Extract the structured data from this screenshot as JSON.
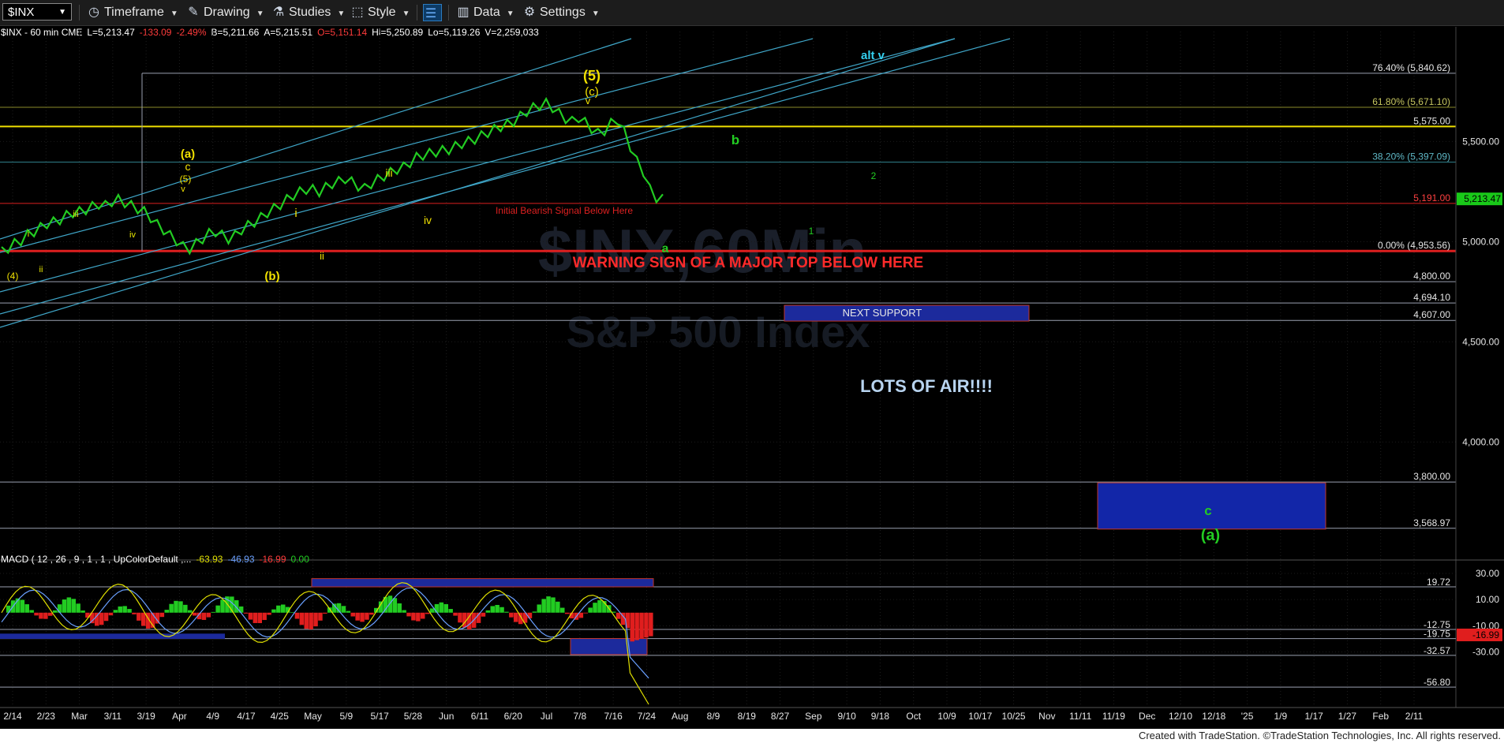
{
  "toolbar": {
    "symbol": "$INX",
    "timeframe": "Timeframe",
    "drawing": "Drawing",
    "studies": "Studies",
    "style": "Style",
    "data": "Data",
    "settings": "Settings"
  },
  "header": {
    "title": "$INX - 60 min  CME",
    "last": "L=5,213.47",
    "chg": "-133.09",
    "pct": "-2.49%",
    "bid": "B=5,211.66",
    "ask": "A=5,215.51",
    "open": "O=5,151.14",
    "high": "Hi=5,250.89",
    "low": "Lo=5,119.26",
    "vol": "V=2,259,033"
  },
  "watermark": {
    "line1": "$INX,60Min",
    "line2": "S&P 500 Index"
  },
  "colors": {
    "price": "#22cc22",
    "fib": "#9aa0b0",
    "channel": "#3fa6c8",
    "resistance": "#f0e000",
    "signal": "#dd1f1f",
    "support_box": "#1c2a9c"
  },
  "chart_data": {
    "type": "line",
    "title": "$INX - 60 min",
    "price_axis": {
      "ticks": [
        5500,
        5000,
        4500,
        4000
      ],
      "labels": [
        "5,500.00",
        "5,000.00",
        "4,500.00",
        "4,000.00"
      ],
      "ylim": [
        3450,
        5990
      ],
      "scale": "linear"
    },
    "time_axis": {
      "labels": [
        "2/14",
        "2/23",
        "Mar",
        "3/11",
        "3/19",
        "Apr",
        "4/9",
        "4/17",
        "4/25",
        "May",
        "5/9",
        "5/17",
        "5/28",
        "Jun",
        "6/11",
        "6/20",
        "Jul",
        "7/8",
        "7/16",
        "7/24",
        "Aug",
        "8/9",
        "8/19",
        "8/27",
        "Sep",
        "9/10",
        "9/18",
        "Oct",
        "10/9",
        "10/17",
        "10/25",
        "Nov",
        "11/11",
        "11/19",
        "Dec",
        "12/10",
        "12/18",
        "'25",
        "1/9",
        "1/17",
        "1/27",
        "Feb",
        "2/11"
      ]
    },
    "last_price": {
      "value": 5213.47,
      "label": "5,213.47"
    },
    "series": [
      {
        "values": [
          4950,
          4968,
          4990,
          5005,
          5035,
          5050,
          5070,
          5090,
          5098,
          5110,
          5130,
          5145,
          5150,
          5160,
          5175,
          5188,
          5180,
          5200,
          5210,
          5195,
          5180,
          5165,
          5150,
          5120,
          5085,
          5060,
          5030,
          5005,
          4975,
          4965,
          4990,
          5015,
          5040,
          5050,
          5032,
          5015,
          5030,
          5060,
          5080,
          5098,
          5120,
          5145,
          5165,
          5185,
          5210,
          5232,
          5248,
          5262,
          5260,
          5250,
          5270,
          5290,
          5300,
          5315,
          5298,
          5278,
          5265,
          5290,
          5310,
          5328,
          5345,
          5362,
          5372,
          5395,
          5420,
          5432,
          5440,
          5448,
          5455,
          5460,
          5475,
          5490,
          5500,
          5512,
          5528,
          5545,
          5560,
          5575,
          5585,
          5600,
          5625,
          5650,
          5668,
          5680,
          5690,
          5670,
          5640,
          5615,
          5600,
          5620,
          5595,
          5565,
          5540,
          5555,
          5590,
          5610,
          5550,
          5475,
          5400,
          5350,
          5260,
          5220,
          5213
        ]
      }
    ],
    "horizontal_levels": [
      {
        "value": 5840.62,
        "label": "76.40% (5,840.62)"
      },
      {
        "value": 5671.1,
        "label": "61.80% (5,671.10)"
      },
      {
        "value": 5575.0,
        "label": "5,575.00"
      },
      {
        "value": 5397.09,
        "label": "38.20% (5,397.09)"
      },
      {
        "value": 5191.0,
        "label": "5,191.00"
      },
      {
        "value": 4953.56,
        "label": "0.00% (4,953.56)"
      },
      {
        "value": 4800.0,
        "label": "4,800.00"
      },
      {
        "value": 4694.1,
        "label": "4,694.10"
      },
      {
        "value": 4607.0,
        "label": "4,607.00"
      },
      {
        "value": 3800.0,
        "label": "3,800.00"
      },
      {
        "value": 3568.97,
        "label": "3,568.97"
      }
    ],
    "annotations": [
      {
        "text": "WARNING SIGN OF A MAJOR TOP BELOW HERE"
      },
      {
        "text": "Initial Bearish Signal Below Here"
      },
      {
        "text": "NEXT SUPPORT"
      },
      {
        "text": "LOTS OF AIR!!!!"
      },
      {
        "text": "alt v"
      }
    ],
    "wave_labels": [
      "(5)",
      "(c)",
      "v",
      "(a)",
      "c",
      "(5)",
      "v",
      "(b)",
      "iii",
      "iv",
      "i",
      "ii",
      "iii",
      "i",
      "ii",
      "iv",
      "(4)",
      "a",
      "b",
      "2",
      "1",
      "c",
      "(a)"
    ],
    "macd": {
      "label": "MACD ( 12 , 26 , 9 , 1 , 1 , UpColorDefault ,...",
      "values": {
        "macd": "-63.93",
        "signal": "-46.93",
        "hist": "-16.99",
        "zero": "0.00"
      },
      "axis_ticks": [
        30,
        10,
        -10,
        -30
      ],
      "axis_labels": [
        "30.00",
        "10.00",
        "-10.00",
        "-30.00"
      ],
      "ylim": [
        -70,
        36
      ],
      "levels": [
        {
          "value": 19.72,
          "label": "19.72"
        },
        {
          "value": -12.75,
          "label": "-12.75"
        },
        {
          "value": -19.75,
          "label": "-19.75"
        },
        {
          "value": -32.57,
          "label": "-32.57"
        },
        {
          "value": -56.8,
          "label": "-56.80"
        }
      ],
      "last_hist_label": "-16.99"
    }
  },
  "footer": {
    "credit": "Created with TradeStation. ©TradeStation Technologies, Inc. All rights reserved."
  }
}
